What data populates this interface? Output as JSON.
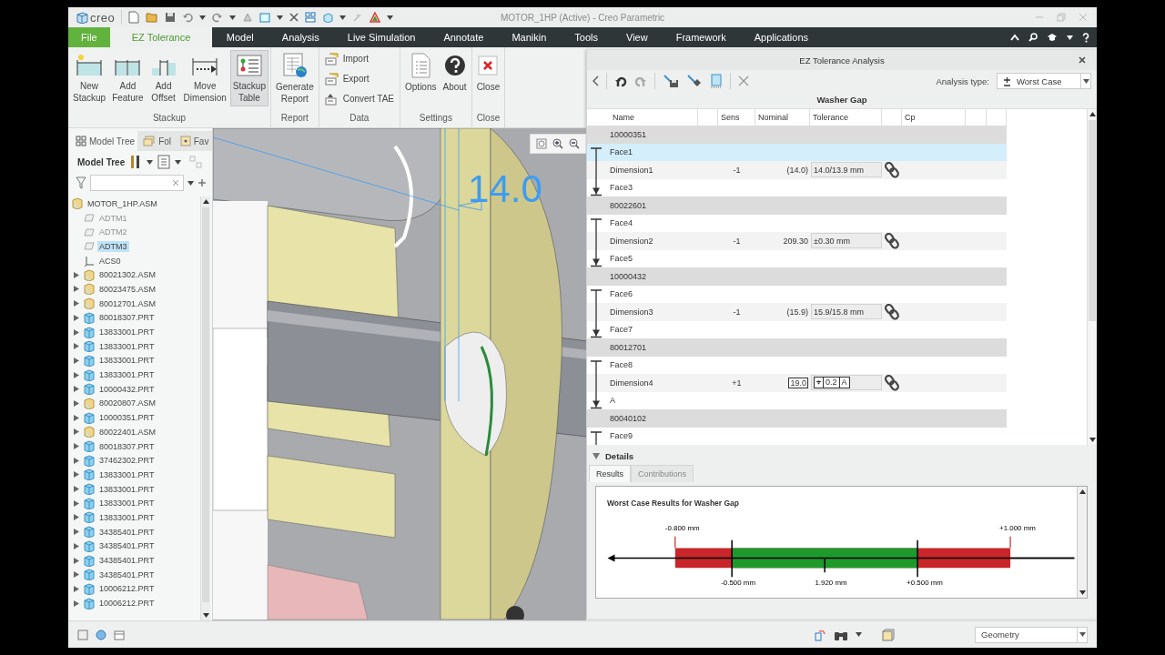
{
  "window": {
    "app_name": "creo",
    "title": "MOTOR_1HP (Active) - Creo Parametric"
  },
  "ribbon_tabs": [
    {
      "label": "File",
      "selected": false,
      "kind": "file"
    },
    {
      "label": "EZ Tolerance",
      "selected": true,
      "kind": "tab"
    },
    {
      "label": "Model",
      "selected": false,
      "kind": "tab"
    },
    {
      "label": "Analysis",
      "selected": false,
      "kind": "tab"
    },
    {
      "label": "Live Simulation",
      "selected": false,
      "kind": "tab"
    },
    {
      "label": "Annotate",
      "selected": false,
      "kind": "tab"
    },
    {
      "label": "Manikin",
      "selected": false,
      "kind": "tab"
    },
    {
      "label": "Tools",
      "selected": false,
      "kind": "tab"
    },
    {
      "label": "View",
      "selected": false,
      "kind": "tab"
    },
    {
      "label": "Framework",
      "selected": false,
      "kind": "tab"
    },
    {
      "label": "Applications",
      "selected": false,
      "kind": "tab"
    }
  ],
  "ribbon_groups": [
    {
      "title": "Stackup",
      "buttons": [
        {
          "label": "New\nStackup",
          "kind": "large",
          "pressed": false
        },
        {
          "label": "Add\nFeature",
          "kind": "large",
          "pressed": false
        },
        {
          "label": "Add\nOffset",
          "kind": "large",
          "pressed": false
        },
        {
          "label": "Move\nDimension",
          "kind": "large",
          "pressed": false
        },
        {
          "label": "Stackup\nTable",
          "kind": "large",
          "pressed": true
        }
      ]
    },
    {
      "title": "Report",
      "buttons": [
        {
          "label": "Generate\nReport",
          "kind": "large",
          "pressed": false
        }
      ]
    },
    {
      "title": "Data",
      "buttons": [
        {
          "label": "Import",
          "kind": "small"
        },
        {
          "label": "Export",
          "kind": "small"
        },
        {
          "label": "Convert TAE",
          "kind": "small"
        }
      ]
    },
    {
      "title": "Settings",
      "buttons": [
        {
          "label": "Options",
          "kind": "large",
          "pressed": false
        },
        {
          "label": "About",
          "kind": "large",
          "pressed": false
        }
      ]
    },
    {
      "title": "Close",
      "buttons": [
        {
          "label": "Close",
          "kind": "large",
          "pressed": false
        }
      ]
    }
  ],
  "model_tree": {
    "tabs": [
      {
        "label": "Model Tree",
        "selected": true
      },
      {
        "label": "Fol",
        "selected": false
      },
      {
        "label": "Fav",
        "selected": false
      }
    ],
    "toolbar_label": "Model Tree",
    "items": [
      {
        "label": "MOTOR_1HP.ASM",
        "kind": "assembly",
        "selected": false,
        "disabled": false,
        "children": [
          {
            "label": "ADTM1",
            "kind": "datum-plane",
            "selected": false,
            "disabled": true
          },
          {
            "label": "ADTM2",
            "kind": "datum-plane",
            "selected": false,
            "disabled": true
          },
          {
            "label": "ADTM3",
            "kind": "datum-plane",
            "selected": true,
            "disabled": false
          },
          {
            "label": "ACS0",
            "kind": "csys",
            "selected": false,
            "disabled": false
          },
          {
            "label": "80021302.ASM",
            "kind": "assembly",
            "selected": false,
            "disabled": false
          },
          {
            "label": "80023475.ASM",
            "kind": "assembly",
            "selected": false,
            "disabled": false
          },
          {
            "label": "80012701.ASM",
            "kind": "assembly",
            "selected": false,
            "disabled": false
          },
          {
            "label": "80018307.PRT",
            "kind": "part",
            "selected": false,
            "disabled": false
          },
          {
            "label": "13833001.PRT",
            "kind": "part",
            "selected": false,
            "disabled": false
          },
          {
            "label": "13833001.PRT",
            "kind": "part",
            "selected": false,
            "disabled": false
          },
          {
            "label": "13833001.PRT",
            "kind": "part",
            "selected": false,
            "disabled": false
          },
          {
            "label": "13833001.PRT",
            "kind": "part",
            "selected": false,
            "disabled": false
          },
          {
            "label": "10000432.PRT",
            "kind": "part",
            "selected": false,
            "disabled": false
          },
          {
            "label": "80020807.ASM",
            "kind": "assembly",
            "selected": false,
            "disabled": false
          },
          {
            "label": "10000351.PRT",
            "kind": "part",
            "selected": false,
            "disabled": false
          },
          {
            "label": "80022401.ASM",
            "kind": "assembly",
            "selected": false,
            "disabled": false
          },
          {
            "label": "80018307.PRT",
            "kind": "part",
            "selected": false,
            "disabled": false
          },
          {
            "label": "37462302.PRT",
            "kind": "part",
            "selected": false,
            "disabled": false
          },
          {
            "label": "13833001.PRT",
            "kind": "part",
            "selected": false,
            "disabled": false
          },
          {
            "label": "13833001.PRT",
            "kind": "part",
            "selected": false,
            "disabled": false
          },
          {
            "label": "13833001.PRT",
            "kind": "part",
            "selected": false,
            "disabled": false
          },
          {
            "label": "13833001.PRT",
            "kind": "part",
            "selected": false,
            "disabled": false
          },
          {
            "label": "34385401.PRT",
            "kind": "part",
            "selected": false,
            "disabled": false
          },
          {
            "label": "34385401.PRT",
            "kind": "part",
            "selected": false,
            "disabled": false
          },
          {
            "label": "34385401.PRT",
            "kind": "part",
            "selected": false,
            "disabled": false
          },
          {
            "label": "34385401.PRT",
            "kind": "part",
            "selected": false,
            "disabled": false
          },
          {
            "label": "10006212.PRT",
            "kind": "part",
            "selected": false,
            "disabled": false
          },
          {
            "label": "10006212.PRT",
            "kind": "part",
            "selected": false,
            "disabled": false
          }
        ]
      }
    ]
  },
  "viewport": {
    "dimension_label": "14.0"
  },
  "analysis_panel": {
    "title": "EZ Tolerance Analysis",
    "analysis_type_label": "Analysis type:",
    "analysis_type": "Worst Case",
    "stack_name": "Washer Gap",
    "columns": [
      "Name",
      "Sens",
      "Nominal",
      "Tolerance",
      "Cp"
    ],
    "groups": [
      {
        "part": "10000351",
        "rows": [
          {
            "kind": "feature",
            "name": "Face1",
            "selected": true
          },
          {
            "kind": "dimension",
            "name": "Dimension1",
            "selected": false,
            "sens": "-1",
            "nominal": "(14.0)",
            "basic": false,
            "tolerance": {
              "kind": "text",
              "text": "14.0/13.9 mm"
            }
          },
          {
            "kind": "feature",
            "name": "Face3",
            "selected": false
          }
        ]
      },
      {
        "part": "80022601",
        "rows": [
          {
            "kind": "feature",
            "name": "Face4",
            "selected": false
          },
          {
            "kind": "dimension",
            "name": "Dimension2",
            "selected": false,
            "sens": "-1",
            "nominal": "209.30",
            "basic": false,
            "tolerance": {
              "kind": "text",
              "text": "±0.30 mm"
            }
          },
          {
            "kind": "feature",
            "name": "Face5",
            "selected": false
          }
        ]
      },
      {
        "part": "10000432",
        "rows": [
          {
            "kind": "feature",
            "name": "Face6",
            "selected": false
          },
          {
            "kind": "dimension",
            "name": "Dimension3",
            "selected": false,
            "sens": "-1",
            "nominal": "(15.9)",
            "basic": false,
            "tolerance": {
              "kind": "text",
              "text": "15.9/15.8 mm"
            }
          },
          {
            "kind": "feature",
            "name": "Face7",
            "selected": false
          }
        ]
      },
      {
        "part": "80012701",
        "rows": [
          {
            "kind": "feature",
            "name": "Face8",
            "selected": false
          },
          {
            "kind": "dimension",
            "name": "Dimension4",
            "selected": false,
            "sens": "+1",
            "nominal": "19.0",
            "basic": true,
            "tolerance": {
              "kind": "frame",
              "cells": [
                "⌖",
                "0.2",
                "A"
              ]
            }
          },
          {
            "kind": "feature",
            "name": "A",
            "selected": false
          }
        ]
      },
      {
        "part": "80040102",
        "rows": [
          {
            "kind": "feature",
            "name": "Face9",
            "selected": false
          }
        ]
      }
    ],
    "details": {
      "label": "Details",
      "expanded": true,
      "tabs": [
        {
          "label": "Results",
          "selected": true
        },
        {
          "label": "Contributions",
          "selected": false
        }
      ],
      "result_title": "Worst Case Results for Washer Gap",
      "lower_limit": "-0.800 mm",
      "upper_limit": "+1.000 mm",
      "min": "-0.500 mm",
      "nominal": "1.920 mm",
      "max": "+0.500 mm"
    }
  },
  "status_bar": {
    "filter": "Geometry"
  }
}
